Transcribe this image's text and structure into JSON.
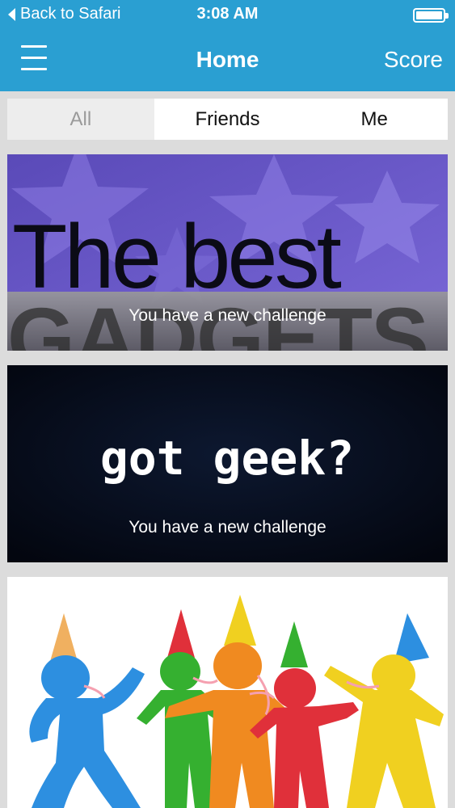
{
  "status_bar": {
    "back_label": "Back to Safari",
    "time": "3:08 AM",
    "battery": "full"
  },
  "nav": {
    "menu_icon": "hamburger-icon",
    "title": "Home",
    "right_link": "Score"
  },
  "tabs": [
    {
      "label": "All",
      "selected": true
    },
    {
      "label": "Friends",
      "selected": false
    },
    {
      "label": "Me",
      "selected": false
    }
  ],
  "feed": [
    {
      "image_text_line1": "The best",
      "image_text_line2": "GADGETS",
      "caption": "You have a new challenge"
    },
    {
      "image_text": "got geek?",
      "caption": "You have a new challenge"
    },
    {
      "image": "party-figures-illustration"
    }
  ],
  "colors": {
    "accent": "#2a9fd2",
    "background": "#dcdcdc",
    "card1_purple": "#6a5acd",
    "card2_dark": "#050b1e"
  }
}
